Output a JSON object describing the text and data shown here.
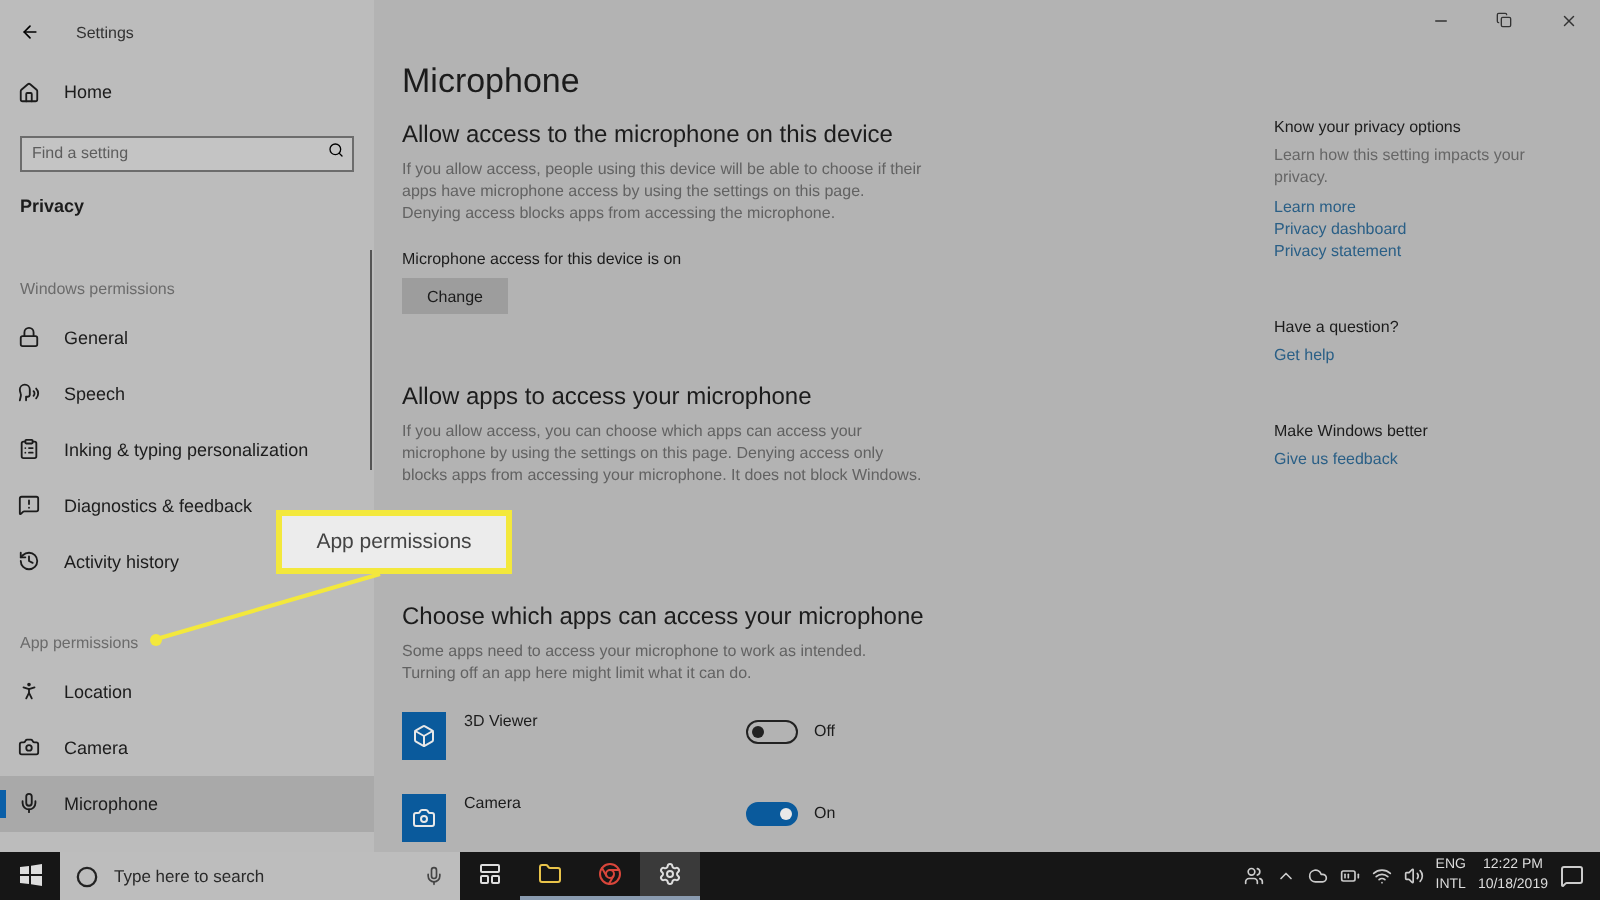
{
  "window": {
    "title": "Settings"
  },
  "sidebar": {
    "home": "Home",
    "search": {
      "placeholder": "Find a setting"
    },
    "section": "Privacy",
    "groups": [
      {
        "heading": "Windows permissions",
        "items": [
          {
            "label": "General",
            "selected": false
          },
          {
            "label": "Speech",
            "selected": false
          },
          {
            "label": "Inking & typing personalization",
            "selected": false
          },
          {
            "label": "Diagnostics & feedback",
            "selected": false
          },
          {
            "label": "Activity history",
            "selected": false
          }
        ]
      },
      {
        "heading": "App permissions",
        "items": [
          {
            "label": "Location",
            "selected": false
          },
          {
            "label": "Camera",
            "selected": false
          },
          {
            "label": "Microphone",
            "selected": true
          }
        ]
      }
    ]
  },
  "callout": {
    "text": "App permissions"
  },
  "main": {
    "title": "Microphone",
    "sections": [
      {
        "heading": "Allow access to the microphone on this device",
        "text": "If you allow access, people using this device will be able to choose if their apps have microphone access by using the settings on this page. Denying access blocks apps from accessing the microphone.",
        "status": "Microphone access for this device is on",
        "button": "Change"
      },
      {
        "heading": "Allow apps to access your microphone",
        "text": "If you allow access, you can choose which apps can access your microphone by using the settings on this page. Denying access only blocks apps from accessing your microphone. It does not block Windows."
      },
      {
        "heading": "Choose which apps can access your microphone",
        "text": "Some apps need to access your microphone to work as intended. Turning off an app here might limit what it can do.",
        "apps": [
          {
            "name": "3D Viewer",
            "on": false,
            "state": "Off"
          },
          {
            "name": "Camera",
            "on": true,
            "state": "On"
          }
        ]
      }
    ]
  },
  "aside": {
    "groups": [
      {
        "heading": "Know your privacy options",
        "text": "Learn how this setting impacts your privacy.",
        "links": [
          "Learn more",
          "Privacy dashboard",
          "Privacy statement"
        ]
      },
      {
        "heading": "Have a question?",
        "links": [
          "Get help"
        ]
      },
      {
        "heading": "Make Windows better",
        "links": [
          "Give us feedback"
        ]
      }
    ]
  },
  "taskbar": {
    "search": {
      "placeholder": "Type here to search"
    },
    "apps": [
      {
        "open": false,
        "selected": false
      },
      {
        "open": true,
        "selected": false
      },
      {
        "open": true,
        "selected": false
      },
      {
        "open": true,
        "selected": true
      }
    ],
    "language": "ENG",
    "layout": "INTL",
    "time": "12:22 PM",
    "date": "10/18/2019"
  }
}
